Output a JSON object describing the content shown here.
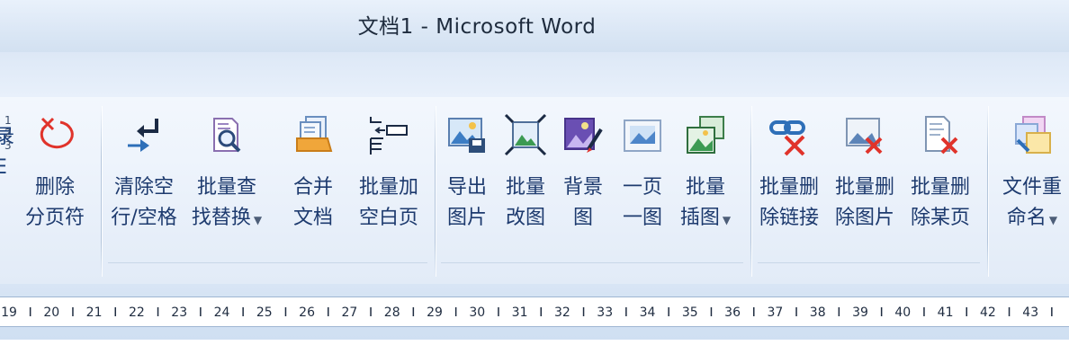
{
  "window": {
    "title": "文档1 - Microsoft Word"
  },
  "edge_group": {
    "labels": [
      "录",
      "E"
    ]
  },
  "ribbon": {
    "buttons": [
      {
        "id": "delete-page-break",
        "line1": "删除",
        "line2": "分页符",
        "dropdown": false,
        "icon": "delete-page-break-icon"
      },
      {
        "id": "clear-blank-lines",
        "line1": "清除空",
        "line2": "行/空格",
        "dropdown": false,
        "icon": "enter-arrow-icon"
      },
      {
        "id": "batch-find-replace",
        "line1": "批量查",
        "line2": "找替换",
        "dropdown": true,
        "icon": "find-replace-icon"
      },
      {
        "id": "merge-docs",
        "line1": "合并",
        "line2": "文档",
        "dropdown": false,
        "icon": "merge-docs-icon"
      },
      {
        "id": "batch-add-blank",
        "line1": "批量加",
        "line2": "空白页",
        "dropdown": false,
        "icon": "add-blank-page-icon"
      },
      {
        "id": "export-images",
        "line1": "导出",
        "line2": "图片",
        "dropdown": false,
        "icon": "export-image-icon"
      },
      {
        "id": "batch-resize-images",
        "line1": "批量",
        "line2": "改图",
        "dropdown": false,
        "icon": "resize-image-icon"
      },
      {
        "id": "background-image",
        "line1": "背景",
        "line2": "图",
        "dropdown": false,
        "icon": "background-image-icon"
      },
      {
        "id": "one-image-per-page",
        "line1": "一页",
        "line2": "一图",
        "dropdown": false,
        "icon": "single-image-icon"
      },
      {
        "id": "batch-insert-images",
        "line1": "批量",
        "line2": "插图",
        "dropdown": true,
        "icon": "insert-images-icon"
      },
      {
        "id": "batch-delete-links",
        "line1": "批量删",
        "line2": "除链接",
        "dropdown": false,
        "icon": "delete-link-icon"
      },
      {
        "id": "batch-delete-images",
        "line1": "批量删",
        "line2": "除图片",
        "dropdown": false,
        "icon": "delete-image-icon"
      },
      {
        "id": "batch-delete-pages",
        "line1": "批量删",
        "line2": "除某页",
        "dropdown": false,
        "icon": "delete-page-icon"
      },
      {
        "id": "rename-files",
        "line1": "文件重",
        "line2": "命名",
        "dropdown": true,
        "icon": "rename-files-icon"
      }
    ]
  },
  "ruler": {
    "numbers": [
      "19",
      "20",
      "21",
      "22",
      "23",
      "24",
      "25",
      "26",
      "27",
      "28",
      "29",
      "30",
      "31",
      "32",
      "33",
      "34",
      "35",
      "36",
      "37",
      "38",
      "39",
      "40",
      "41",
      "42",
      "43"
    ]
  },
  "colors": {
    "label_blue": "#1d3a6e",
    "accent_red": "#e0332b",
    "accent_blue": "#2e6fb8",
    "accent_green": "#3c9a52",
    "ribbon_bg": "#eef4fc"
  }
}
